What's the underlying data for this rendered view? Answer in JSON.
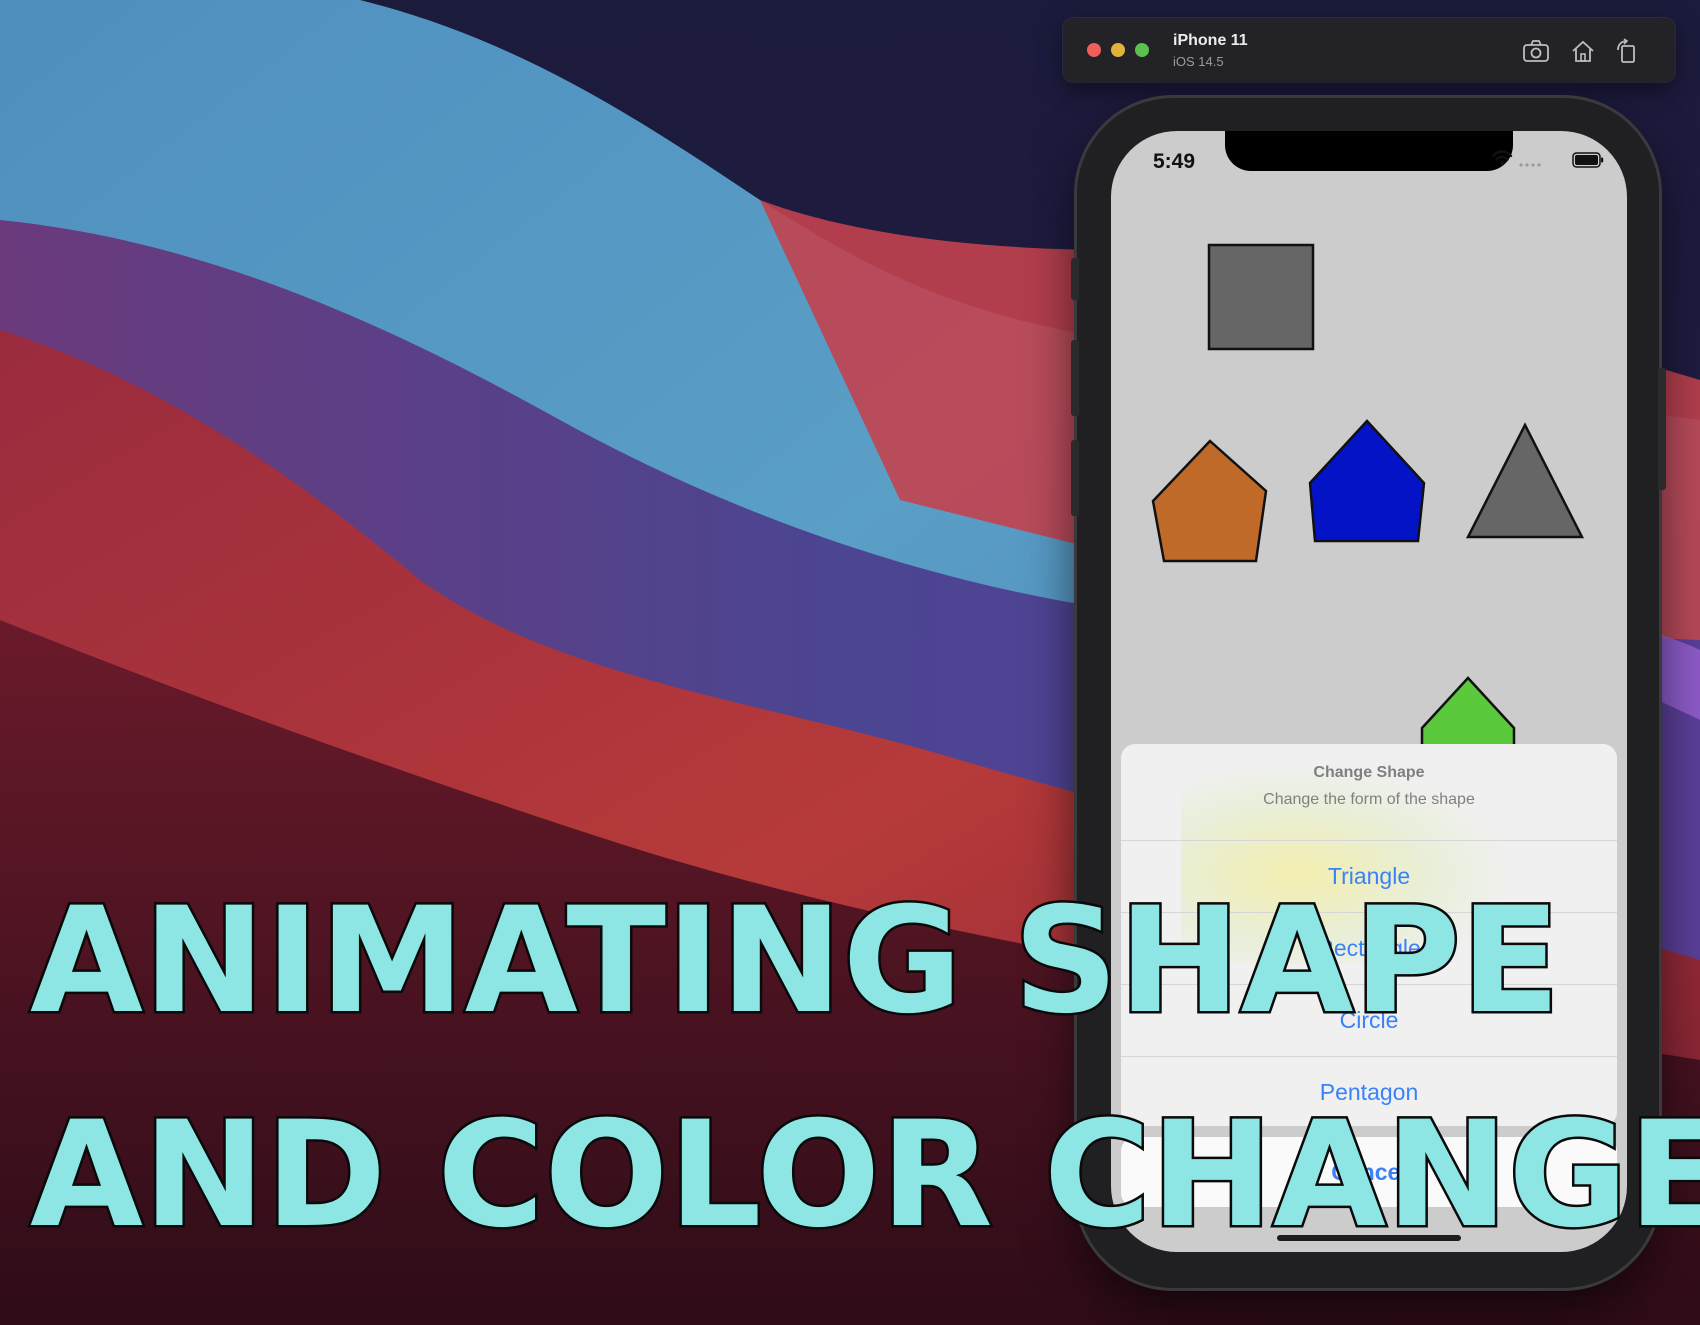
{
  "simulator": {
    "device_name": "iPhone 11",
    "os_version": "iOS 14.5",
    "toolbar_icons": [
      "screenshot-icon",
      "home-icon",
      "rotate-icon"
    ]
  },
  "status_bar": {
    "time": "5:49",
    "icons": [
      "cellular-icon",
      "wifi-icon",
      "battery-icon"
    ]
  },
  "shapes": [
    {
      "name": "square",
      "color": "#666666"
    },
    {
      "name": "pentagon",
      "color": "#bf6a28"
    },
    {
      "name": "pentagon",
      "color": "#0413c5"
    },
    {
      "name": "triangle",
      "color": "#666666"
    },
    {
      "name": "pentagon",
      "color": "#5ac93c"
    }
  ],
  "action_sheet": {
    "title": "Change Shape",
    "message": "Change the form of the shape",
    "options": [
      "Triangle",
      "Rectangle",
      "Circle",
      "Pentagon"
    ],
    "cancel": "Cancel"
  },
  "caption": {
    "line1": "ANIMATING SHAPE",
    "line2": "AND COLOR CHANGE",
    "color": "#8ee6e4"
  },
  "accent_color": "#3a82f7"
}
